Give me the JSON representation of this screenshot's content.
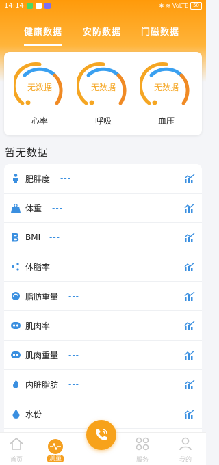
{
  "status_bar": {
    "time": "14:14",
    "network": "VoLTE",
    "battery": "50"
  },
  "tabs": [
    {
      "label": "健康数据",
      "active": true
    },
    {
      "label": "安防数据",
      "active": false
    },
    {
      "label": "门磁数据",
      "active": false
    }
  ],
  "vitals": [
    {
      "value": "无数据",
      "label": "心率"
    },
    {
      "value": "无数据",
      "label": "呼吸"
    },
    {
      "value": "无数据",
      "label": "血压"
    }
  ],
  "section_title": "暂无数据",
  "metrics": [
    {
      "name": "肥胖度",
      "value": "---",
      "icon": "body-icon"
    },
    {
      "name": "体重",
      "value": "---",
      "icon": "kg-icon"
    },
    {
      "name": "BMI",
      "value": "---",
      "icon": "bmi-icon"
    },
    {
      "name": "体脂率",
      "value": "---",
      "icon": "body-fat-icon"
    },
    {
      "name": "脂肪重量",
      "value": "---",
      "icon": "fat-weight-icon"
    },
    {
      "name": "肌肉率",
      "value": "---",
      "icon": "muscle-icon"
    },
    {
      "name": "肌肉重量",
      "value": "---",
      "icon": "muscle-weight-icon"
    },
    {
      "name": "内脏脂肪",
      "value": "---",
      "icon": "visceral-fat-icon"
    },
    {
      "name": "水份",
      "value": "---",
      "icon": "water-icon"
    }
  ],
  "bottom_nav": [
    {
      "label": "首页",
      "icon": "home-icon",
      "active": false
    },
    {
      "label": "测量",
      "icon": "pulse-icon",
      "active": true
    },
    {
      "label": "服务",
      "icon": "grid-icon",
      "active": false
    },
    {
      "label": "我的",
      "icon": "user-icon",
      "active": false
    }
  ],
  "colors": {
    "accent": "#ff9a0a",
    "value_blue": "#3a8fe0",
    "gauge_blue": "#3aa0f0",
    "gauge_orange": "#f08a24"
  }
}
